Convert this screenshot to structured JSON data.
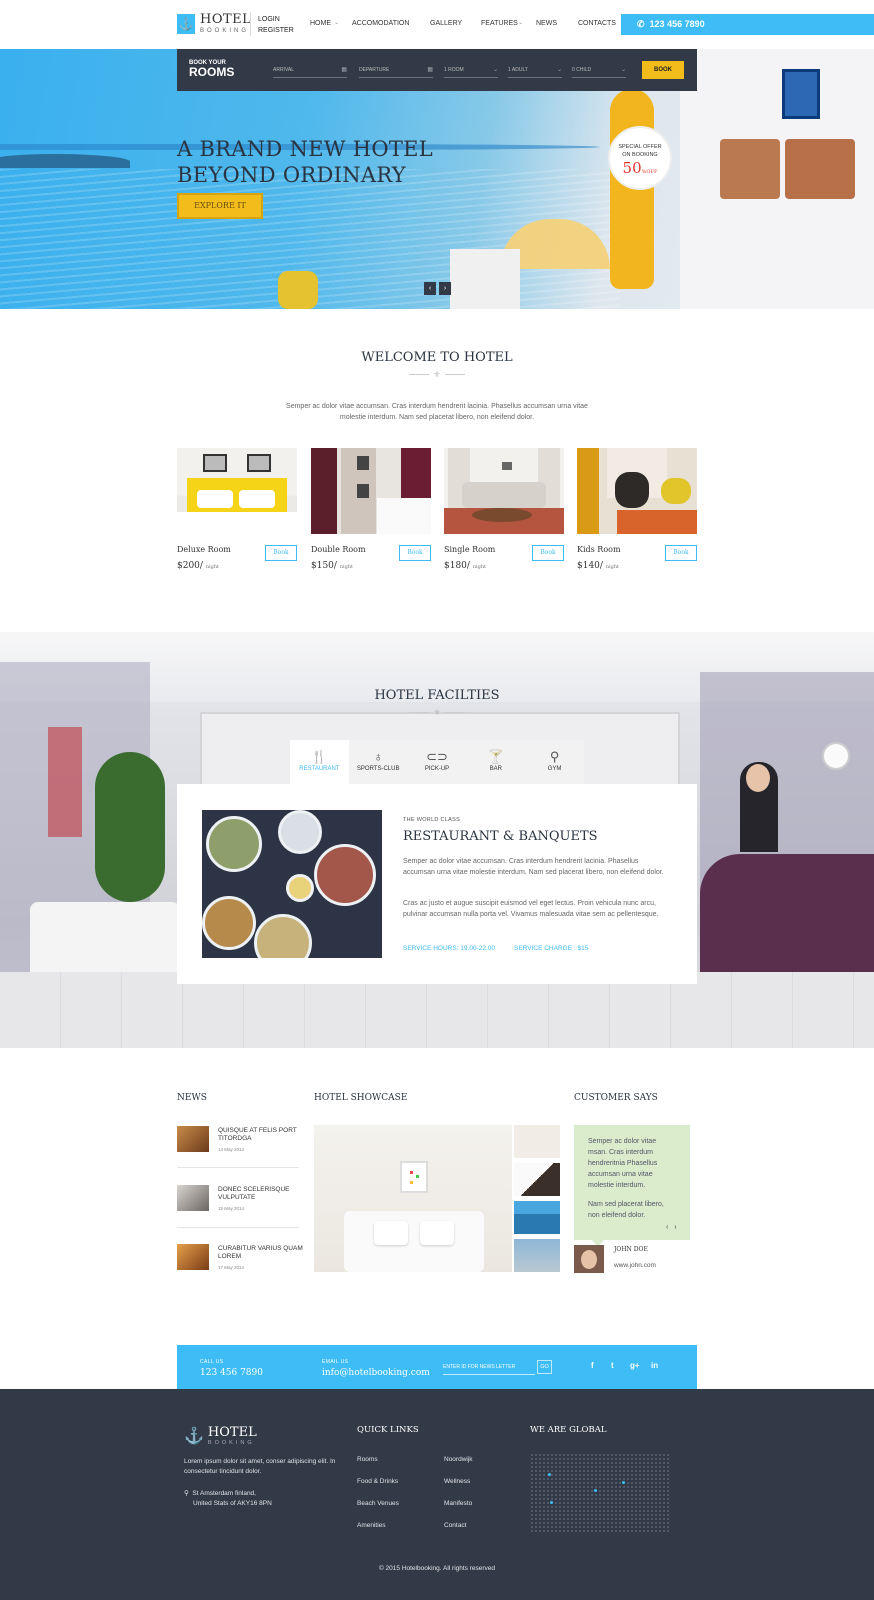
{
  "header": {
    "logo_title": "HOTEL",
    "logo_sub": "BOOKING",
    "login": "LOGIN",
    "register": "REGISTER",
    "nav": [
      "HOME",
      "ACCOMODATION",
      "GALLERY",
      "FEATURES",
      "NEWS",
      "CONTACTS"
    ],
    "phone": "123 456 7890"
  },
  "booking": {
    "label_small": "BOOK YOUR",
    "label_big": "ROOMS",
    "arrival": "ARRIVAL",
    "departure": "DEPARTURE",
    "rooms": "1 ROOM",
    "adults": "1 ADULT",
    "children": "0 CHILD",
    "book": "BOOK"
  },
  "hero": {
    "title_line1": "A BRAND NEW HOTEL",
    "title_line2": "BEYOND ORDINARY",
    "cta": "EXPLORE IT",
    "offer_line1": "SPECIAL OFFER",
    "offer_line2": "ON BOOKING",
    "offer_pct": "50",
    "offer_unit": "%",
    "offer_off": "OFF",
    "prev": "‹",
    "next": "›"
  },
  "welcome": {
    "title": "WELCOME TO HOTEL",
    "divider": "⚜",
    "text": "Semper ac dolor vitae accumsan. Cras interdum hendrerit lacinia. Phasellus accumsan urna vitae molestie interdum. Nam sed placerat libero, non eleifend dolor."
  },
  "rooms": [
    {
      "name": "Deluxe Room",
      "price": "$200/",
      "unit": "night",
      "book": "Book"
    },
    {
      "name": "Double Room",
      "price": "$150/",
      "unit": "night",
      "book": "Book"
    },
    {
      "name": "Single Room",
      "price": "$180/",
      "unit": "night",
      "book": "Book"
    },
    {
      "name": "Kids Room",
      "price": "$140/",
      "unit": "night",
      "book": "Book"
    }
  ],
  "facilities": {
    "title": "HOTEL FACILTIES",
    "divider": "⚜",
    "tabs": [
      {
        "label": "RESTAURANT",
        "icon": "fork-knife-icon",
        "glyph": "🍴"
      },
      {
        "label": "SPORTS-CLUB",
        "icon": "balloon-icon",
        "glyph": "♁"
      },
      {
        "label": "PICK-UP",
        "icon": "car-icon",
        "glyph": "⊂⊃"
      },
      {
        "label": "BAR",
        "icon": "cocktail-icon",
        "glyph": "🍸"
      },
      {
        "label": "GYM",
        "icon": "treadmill-icon",
        "glyph": "⚲"
      }
    ],
    "subtitle": "THE WORLD CLASS",
    "heading": "RESTAURANT & BANQUETS",
    "para1": "Semper ac dolor vitae accumsan. Cras interdum hendrerit lacinia. Phasellus accumsan urna vitae molestie interdum. Nam sed placerat libero, non eleifend dolor.",
    "para2": "Cras ac justo et augue suscipit euismod vel eget lectus. Proin vehicula nunc arcu, pulvinar accumsan nulla porta vel. Vivamus malesuada vitae sem ac pellentesque.",
    "hours": "SERVICE HOURS: 19.00-22.00",
    "charge": "SERVICE CHARGE : $15"
  },
  "news": {
    "title": "NEWS",
    "items": [
      {
        "title": "QUISQUE AT FELIS PORT TITORDGA",
        "date": "14 May 2014"
      },
      {
        "title": "DONEC SCELERISQUE VULPUTATE",
        "date": "15 May 2014"
      },
      {
        "title": "CURABITUR VARIUS QUAM LOREM",
        "date": "17 May 2014"
      }
    ]
  },
  "showcase": {
    "title": "HOTEL SHOWCASE"
  },
  "testimonial": {
    "title": "CUSTOMER SAYS",
    "text1": "Semper ac dolor vitae msan. Cras interdum hendreritnia Phasellus accumsan urna vitae molestie interdum.",
    "text2": "Nam sed placerat libero, non eleifend dolor.",
    "prev": "‹",
    "next": "›",
    "name": "JOHN DOE",
    "url": "www.john.com"
  },
  "contact_bar": {
    "call_label": "CALL US",
    "call_value": "123 456 7890",
    "email_label": "EMAIL US",
    "email_value": "info@hotelbooking.com",
    "newsletter_placeholder": "ENTER ID FOR NEWS LETTER",
    "go": "GO",
    "social": [
      "f",
      "t",
      "g+",
      "in"
    ]
  },
  "footer": {
    "logo_title": "HOTEL",
    "logo_sub": "BOOKING",
    "about": "Lorem ipsum dolor sit amet, conser adipiscing elit. In consectetur tincidunt dolor.",
    "address_line1": "St Amsterdam finland,",
    "address_line2": "United Stats of AKY16 8PN",
    "quick_links_title": "QUICK LINKS",
    "links_col1": [
      "Rooms",
      "Food & Drinks",
      "Beach Venues",
      "Amenities"
    ],
    "links_col2": [
      "Noordwijk",
      "Wellness",
      "Manifesto",
      "Contact"
    ],
    "global_title": "WE ARE GLOBAL",
    "copyright": "© 2015 Hotelbooking. All rights reserved"
  },
  "colors": {
    "accent": "#3dbcf6",
    "dark": "#333a47",
    "yellow": "#f2bc1b",
    "offer_red": "#e5392b"
  }
}
